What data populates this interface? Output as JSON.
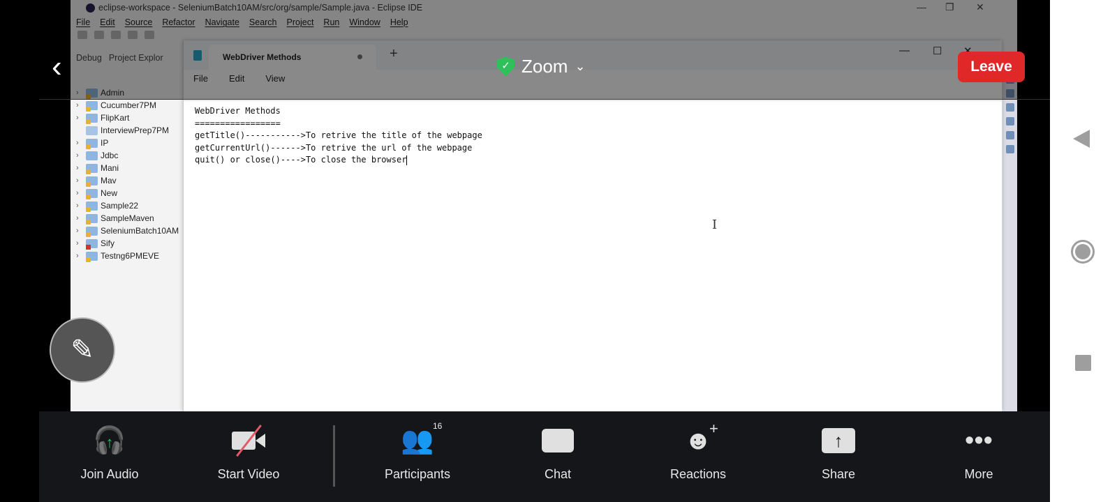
{
  "eclipse": {
    "title": "eclipse-workspace - SeleniumBatch10AM/src/org/sample/Sample.java - Eclipse IDE",
    "menu": [
      "File",
      "Edit",
      "Source",
      "Refactor",
      "Navigate",
      "Search",
      "Project",
      "Run",
      "Window",
      "Help"
    ],
    "views": {
      "debug": "Debug",
      "project_explorer": "Project Explor"
    },
    "projects": [
      {
        "name": "Admin",
        "icon": "maven-warn"
      },
      {
        "name": "Cucumber7PM",
        "icon": "maven-warn"
      },
      {
        "name": "FlipKart",
        "icon": "maven-warn"
      },
      {
        "name": "InterviewPrep7PM",
        "icon": "folder"
      },
      {
        "name": "IP",
        "icon": "java-warn"
      },
      {
        "name": "Jdbc",
        "icon": "java"
      },
      {
        "name": "Mani",
        "icon": "maven-warn"
      },
      {
        "name": "Mav",
        "icon": "maven-warn"
      },
      {
        "name": "New",
        "icon": "maven-warn"
      },
      {
        "name": "Sample22",
        "icon": "maven-warn"
      },
      {
        "name": "SampleMaven",
        "icon": "maven-warn"
      },
      {
        "name": "SeleniumBatch10AM",
        "icon": "java-warn"
      },
      {
        "name": "Sify",
        "icon": "maven-error"
      },
      {
        "name": "Testng6PMEVE",
        "icon": "maven-warn"
      }
    ]
  },
  "notepad": {
    "tab_title": "WebDriver Methods",
    "menu": [
      "File",
      "Edit",
      "View"
    ],
    "lines": [
      "WebDriver Methods",
      "=================",
      "getTitle()----------->To retrive the title of the webpage",
      "getCurrentUrl()------>To retrive the url of the webpage",
      "quit() or close()---->To close the browser"
    ]
  },
  "zoom": {
    "title": "Zoom",
    "leave": "Leave",
    "toolbar": {
      "join_audio": "Join Audio",
      "start_video": "Start Video",
      "participants": "Participants",
      "participants_count": "16",
      "chat": "Chat",
      "reactions": "Reactions",
      "share": "Share",
      "more": "More"
    },
    "colors": {
      "leave": "#e02828",
      "shield": "#2fc05c",
      "bar": "#141619"
    }
  }
}
